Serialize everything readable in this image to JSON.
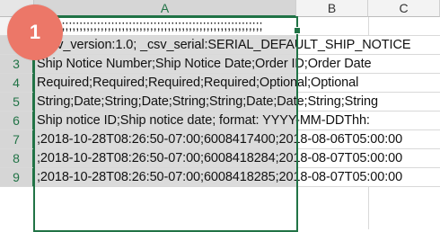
{
  "sheet": {
    "columns": [
      {
        "label": "A",
        "selected": true
      },
      {
        "label": "B",
        "selected": false
      },
      {
        "label": "C",
        "selected": false
      }
    ],
    "rows": [
      {
        "num": "1",
        "text": ";;;;;;;;;;;;;;;;;;;;;;;;;;;;;;;;;;;;;;;;;;;;;;;;;;;;;;;;;;;;;;;;"
      },
      {
        "num": "2",
        "text": "_csv_version:1.0; _csv_serial:SERIAL_DEFAULT_SHIP_NOTICE"
      },
      {
        "num": "3",
        "text": "Ship Notice Number;Ship Notice Date;Order ID;Order Date"
      },
      {
        "num": "4",
        "text": "Required;Required;Required;Required;Optional;Optional"
      },
      {
        "num": "5",
        "text": "String;Date;String;Date;String;String;Date;Date;String;String"
      },
      {
        "num": "6",
        "text": "Ship notice ID;Ship notice date; format: YYYY-MM-DDThh:"
      },
      {
        "num": "7",
        "text": ";2018-10-28T08:26:50-07:00;6008417400;2018-08-06T05:00:00"
      },
      {
        "num": "8",
        "text": ";2018-10-28T08:26:50-07:00;6008418284;2018-08-07T05:00:00"
      },
      {
        "num": "9",
        "text": ";2018-10-28T08:26:50-07:00;6008418285;2018-08-07T05:00:00"
      }
    ]
  },
  "step_badge": {
    "number": "1",
    "color": "#ec7768"
  },
  "colors": {
    "selection_border": "#217346",
    "selection_fill": "#dbdbdb"
  }
}
